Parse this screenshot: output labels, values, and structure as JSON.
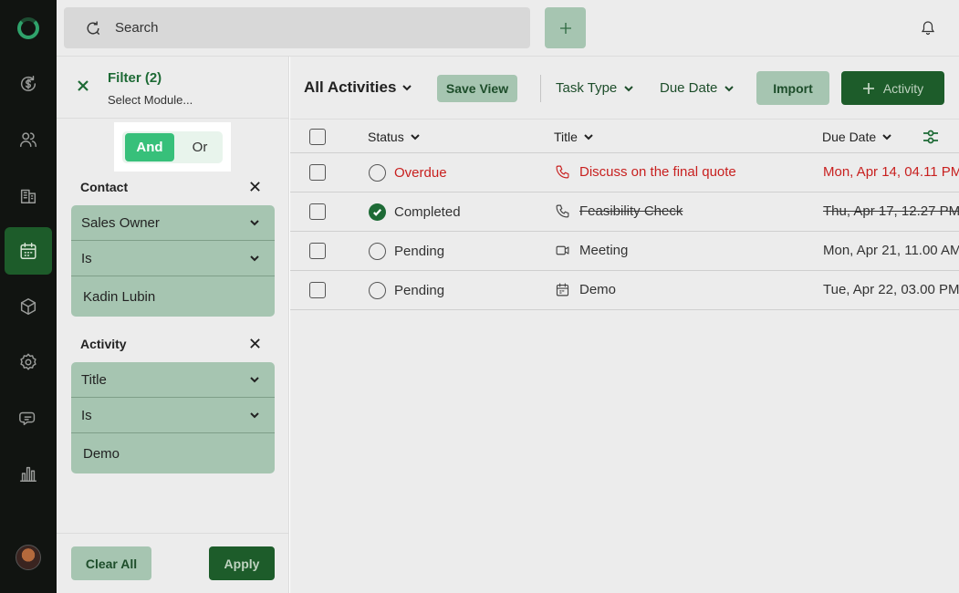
{
  "topbar": {
    "search_placeholder": "Search",
    "icons": [
      "refresh-search-icon",
      "plus-icon",
      "bell-icon"
    ]
  },
  "nav": {
    "items": [
      {
        "name": "deals",
        "icon": "dollar-cycle-icon"
      },
      {
        "name": "contacts",
        "icon": "users-icon"
      },
      {
        "name": "companies",
        "icon": "building-icon"
      },
      {
        "name": "activities",
        "icon": "calendar-icon",
        "active": true
      },
      {
        "name": "products",
        "icon": "box-icon"
      },
      {
        "name": "settings",
        "icon": "gear-icon"
      },
      {
        "name": "messages",
        "icon": "chat-icon"
      },
      {
        "name": "reports",
        "icon": "bar-chart-icon"
      }
    ]
  },
  "filter": {
    "title": "Filter (2)",
    "subtitle": "Select Module...",
    "logic_and": "And",
    "logic_or": "Or",
    "logic_selected": "And",
    "sections": [
      {
        "label": "Contact",
        "field": "Sales Owner",
        "operator": "Is",
        "value": "Kadin Lubin"
      },
      {
        "label": "Activity",
        "field": "Title",
        "operator": "Is",
        "value": "Demo"
      }
    ],
    "clear_label": "Clear All",
    "apply_label": "Apply"
  },
  "toolbar": {
    "view_title": "All Activities",
    "save_view_label": "Save View",
    "filter_task_type": "Task Type",
    "filter_due_date": "Due Date",
    "import_label": "Import",
    "activity_label": "Activity"
  },
  "table": {
    "headers": {
      "status": "Status",
      "title": "Title",
      "due_date": "Due Date"
    },
    "rows": [
      {
        "status": "Overdue",
        "status_kind": "pending",
        "title": "Discuss on the final quote",
        "type_icon": "phone-icon",
        "due": "Mon, Apr 14, 04.11 PM",
        "tone": "overdue"
      },
      {
        "status": "Completed",
        "status_kind": "done",
        "title": "Feasibility Check",
        "type_icon": "phone-icon",
        "due": "Thu, Apr 17, 12.27 PM",
        "tone": "completed"
      },
      {
        "status": "Pending",
        "status_kind": "pending",
        "title": "Meeting",
        "type_icon": "video-icon",
        "due": "Mon, Apr 21, 11.00 AM",
        "tone": "normal"
      },
      {
        "status": "Pending",
        "status_kind": "pending",
        "title": "Demo",
        "type_icon": "calendar-icon",
        "due": "Tue, Apr 22, 03.00 PM",
        "tone": "normal"
      }
    ]
  },
  "colors": {
    "brand_dark": "#1d5c2a",
    "brand_light": "#a6c5b1",
    "toggle_active": "#37c07a",
    "overdue": "#c8201f"
  }
}
